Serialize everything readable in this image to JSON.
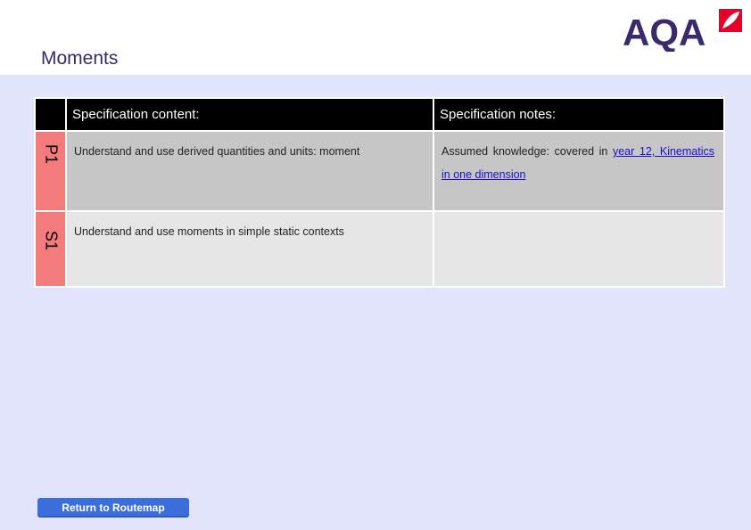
{
  "header": {
    "title": "Moments",
    "logo_text": "AQA",
    "brand_color": "#3b2a6b",
    "accent_color": "#e4002b",
    "logo_icon": "aqa-leaf-icon"
  },
  "table": {
    "headers": {
      "content": "Specification content:",
      "notes": "Specification notes:"
    },
    "rows": [
      {
        "tag": "P1",
        "content": "Understand and use derived quantities and units: moment",
        "notes_prefix": "Assumed knowledge: covered in ",
        "notes_link": "year 12, Kinematics in one dimension"
      },
      {
        "tag": "S1",
        "content": "Understand and use moments in simple static contexts",
        "notes_prefix": "",
        "notes_link": ""
      }
    ]
  },
  "footer": {
    "return_label": "Return to Routemap"
  },
  "colors": {
    "page_background": "#e1e4fb",
    "header_row": "#000000",
    "tag_cell": "#f47b7b",
    "row1_fill": "#c6c6c6",
    "row2_fill": "#e6e6e6",
    "button": "#3a6edb"
  }
}
